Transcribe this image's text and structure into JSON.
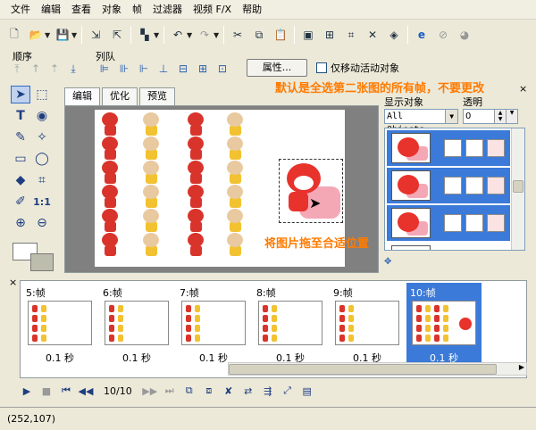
{
  "menu": [
    "文件",
    "编辑",
    "查看",
    "对象",
    "帧",
    "过滤器",
    "视频 F/X",
    "帮助"
  ],
  "toolbar": {
    "icons": [
      "new-icon",
      "open-icon",
      "save-icon",
      "import-icon",
      "export-icon",
      "color-icon",
      "undo-icon",
      "redo-icon",
      "cut-icon",
      "copy-icon",
      "paste-icon",
      "save-frame-icon",
      "insert-frame-icon",
      "crop-icon",
      "export-web-icon",
      "browser-icon",
      "forbid-icon",
      "sphere-icon"
    ]
  },
  "arrange": {
    "label": "顺序",
    "queue_label": "列队",
    "properties_button": "属性...",
    "only_move_active": "仅移动活动对象"
  },
  "tabs": [
    "编辑",
    "优化",
    "预览"
  ],
  "callouts": {
    "top": "默认是全选第二张图的所有帧，不要更改",
    "bottom": "将图片拖至合适位置"
  },
  "right_panel": {
    "show_objects_label": "显示对象",
    "opacity_label": "透明",
    "select_value": "All Objects",
    "opacity_value": "0",
    "close": "×"
  },
  "frames": [
    {
      "label": "5:帧",
      "delay": "0.1 秒"
    },
    {
      "label": "6:帧",
      "delay": "0.1 秒"
    },
    {
      "label": "7:帧",
      "delay": "0.1 秒"
    },
    {
      "label": "8:帧",
      "delay": "0.1 秒"
    },
    {
      "label": "9:帧",
      "delay": "0.1 秒"
    },
    {
      "label": "10:帧",
      "delay": "0.1 秒"
    }
  ],
  "playback": {
    "frame_count": "10/10",
    "close": "×"
  },
  "status": {
    "coords": "(252,107)"
  },
  "colors": {
    "accent": "#3b7ad8",
    "callout": "#ff7a00"
  }
}
